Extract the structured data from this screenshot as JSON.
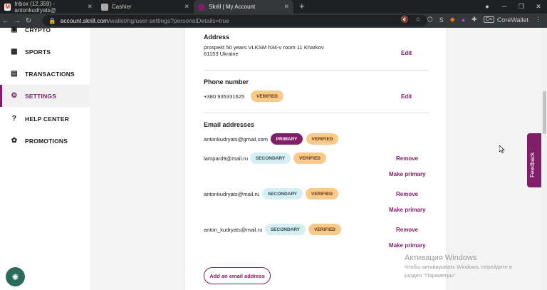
{
  "browser": {
    "tabs": [
      {
        "title": "Inbox (12,359) - antonkudryats@",
        "icon": "gmail-icon"
      },
      {
        "title": "Cashier",
        "icon": "page-icon"
      },
      {
        "title": "Skrill | My Account",
        "icon": "skrill-icon"
      }
    ],
    "new_tab": "+",
    "url_domain": "account.skrill.com",
    "url_path": "/wallet/ng/user-settings?personalDetails=true",
    "extension_s": "S",
    "corewallet_box": "C≡",
    "corewallet": "CoreWallet"
  },
  "sidebar": {
    "items": [
      {
        "label": "CRYPTO",
        "icon": "crypto-icon"
      },
      {
        "label": "SPORTS",
        "icon": "sports-icon"
      },
      {
        "label": "TRANSACTIONS",
        "icon": "transactions-icon"
      },
      {
        "label": "SETTINGS",
        "icon": "gear-icon"
      },
      {
        "label": "HELP CENTER",
        "icon": "help-icon"
      },
      {
        "label": "PROMOTIONS",
        "icon": "promotions-icon"
      }
    ],
    "active_index": 3
  },
  "address": {
    "heading": "Address",
    "line1": "prospekt 50 years VLKSM h34-v room 11 Kharkov",
    "line2": "61153 Ukraine",
    "edit": "Edit"
  },
  "phone": {
    "heading": "Phone number",
    "number": "+380 935331625",
    "badge": "VERIFIED",
    "edit": "Edit"
  },
  "emails": {
    "heading": "Email addresses",
    "list": [
      {
        "email": "antonkudryats@gmail.com",
        "type": "PRIMARY",
        "status": "VERIFIED"
      },
      {
        "email": "lampard9@mail.ru",
        "type": "SECONDARY",
        "status": "VERIFIED",
        "remove": "Remove",
        "make_primary": "Make primary"
      },
      {
        "email": "antonkudryats@mail.ru",
        "type": "SECONDARY",
        "status": "VERIFIED",
        "remove": "Remove",
        "make_primary": "Make primary"
      },
      {
        "email": "anton_kudryats@mail.ru",
        "type": "SECONDARY",
        "status": "VERIFIED",
        "remove": "Remove",
        "make_primary": "Make primary"
      }
    ],
    "add_button": "Add an email address"
  },
  "feedback": "Feedback",
  "watermark": {
    "line1": "Активация Windows",
    "line2": "Чтобы активировать Windows, перейдите в",
    "line3": "раздел \"Параметры\"."
  },
  "colors": {
    "accent": "#811e68",
    "verified": "#fbc98a",
    "secondary": "#d7eef3"
  }
}
